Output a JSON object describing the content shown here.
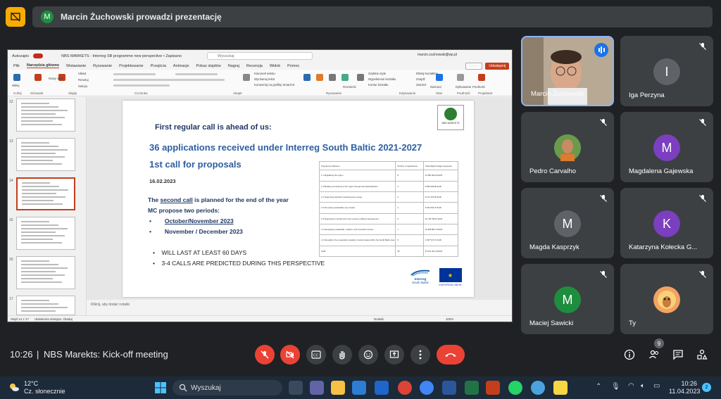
{
  "banner": {
    "avatar_letter": "M",
    "text": "Marcin Żuchowski prowadzi prezentację"
  },
  "powerpoint": {
    "autosave_label": "Autozapis",
    "doc_title": "NBS MARKETS - Interreg SB programme new perspective • Zapisano",
    "search_placeholder": "Wyszukaj",
    "user": "marcin.zuchowski@wp.pl",
    "menu": [
      "Plik",
      "Narzędzia główne",
      "Wstawianie",
      "Rysowanie",
      "Projektowanie",
      "Przejścia",
      "Animacje",
      "Pokaz slajdów",
      "Nagraj",
      "Recenzja",
      "Widok",
      "Pomoc"
    ],
    "active_menu": "Narzędzia główne",
    "share_buttons": [
      "Nagraj",
      "Udostępnij"
    ],
    "ribbon_groups": [
      "Cofnij",
      "Schowek",
      "Slajdy",
      "Czcionka",
      "Akapit",
      "Rysowanie",
      "Edytowanie",
      "Głos",
      "Poufność",
      "Projektant"
    ],
    "ribbon_items": [
      "Wklej",
      "Nowy slajd",
      "Układ",
      "Resetuj",
      "Sekcja",
      "Kierunek tekstu",
      "Wyrównaj tekst",
      "Konwertuj na grafikę SmartArt",
      "Rozmieść",
      "Szybkie style",
      "Wypełnienie kształtu",
      "Kontur kształtu",
      "Efekty kształtów",
      "Znajdź",
      "Zamień",
      "Zaznacz",
      "Dyktowanie",
      "Poufność",
      "Projektant"
    ],
    "thumb_numbers": [
      "12",
      "13",
      "14",
      "15",
      "16",
      "17"
    ],
    "notes_placeholder": "Kliknij, aby dodać notatki",
    "status_slide": "Slajd 14 z 17",
    "status_accessibility": "Ułatwienia dostępu: zbadaj",
    "status_notes": "Notatki",
    "status_zoom": "100%"
  },
  "slide": {
    "heading1": "First regular call is ahead of us:",
    "heading2": "36 applications received under Interreg South Baltic 2021-2027",
    "heading3": "1st call for proposals",
    "date": "16.02.2023",
    "para_pre": "The ",
    "para_underlined": "second call",
    "para_post": " is planned for the end of the year",
    "para2": "MC propose two periods:",
    "periods": [
      "October/November 2023",
      "November / December 2023"
    ],
    "bullets": [
      "WILL LAST AT LEAST 60 DAYS",
      "3-4 CALLS ARE PREDICTED DURING THIS PERSPECTIVE"
    ],
    "logo_text": "NBS MARKETS",
    "interreg_text": "Interreg",
    "interreg_sub": "South Baltic",
    "eu_text": "EUROPEAN UNION",
    "table": {
      "headers": [
        "Programme Measure",
        "Number of applications",
        "Total eligible budget requested"
      ],
      "rows": [
        [
          "1.1 Digitalizing the region",
          "8",
          "11 680 484,63 EUR"
        ],
        [
          "1.2 Building connectivity of the region through internationalization",
          "3",
          "5 893 909,88 EUR"
        ],
        [
          "2.1 Supporting transition towards green energy",
          "4",
          "8 174 187,66 EUR"
        ],
        [
          "2.2 Promoting sustainable use of water",
          "4",
          "6 813 532,75 EUR"
        ],
        [
          "2.3 Supporting a circular and more resource efficient development",
          "5",
          "10 735 799,07 EUR"
        ],
        [
          "3.1 Developing sustainable, resilient, and innovative tourism",
          "7",
          "10 868 852,73 EUR"
        ],
        [
          "4.1 Strengthen the cooperation capacity of actors based within the South Baltic area (including civil society)",
          "5",
          "3 467 547,47 EUR"
        ],
        [
          "SUM",
          "36",
          "57 631 307,23 EUR"
        ]
      ]
    }
  },
  "participants": [
    {
      "name": "Marcin Żuchowski",
      "letter": "",
      "color": "#a59b8e",
      "speaking": true
    },
    {
      "name": "Iga Perzyna",
      "letter": "I",
      "color": "#5f6368",
      "speaking": false
    },
    {
      "name": "Pedro Carvalho",
      "letter": "",
      "color": "#4e8f3a",
      "speaking": false
    },
    {
      "name": "Magdalena Gajewska",
      "letter": "M",
      "color": "#7b3fbf",
      "speaking": false
    },
    {
      "name": "Magda Kasprzyk",
      "letter": "M",
      "color": "#5f6368",
      "speaking": false
    },
    {
      "name": "Katarzyna Kołecka G...",
      "letter": "K",
      "color": "#7b3fbf",
      "speaking": false
    },
    {
      "name": "Maciej Sawicki",
      "letter": "M",
      "color": "#1e8e3e",
      "speaking": false
    },
    {
      "name": "Ty",
      "letter": "",
      "color": "#f4a261",
      "speaking": false
    }
  ],
  "meeting": {
    "time": "10:26",
    "separator": "|",
    "title": "NBS Marekts: Kick-off meeting",
    "people_count": "9"
  },
  "taskbar": {
    "temp": "12°C",
    "weather": "Cz. słonecznie",
    "search": "Wyszukaj",
    "time": "10:26",
    "date": "11.04.2023",
    "notif_count": "2"
  }
}
